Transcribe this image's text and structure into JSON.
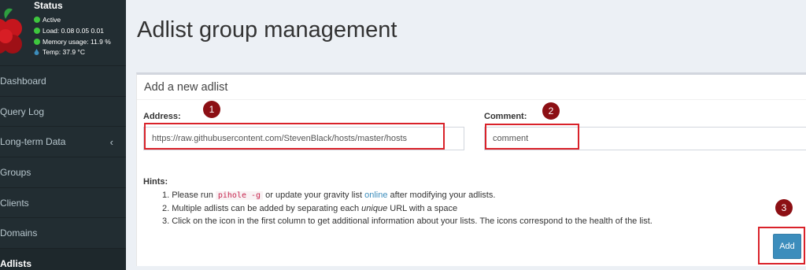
{
  "status": {
    "title": "Status",
    "active": "Active",
    "load": "Load:  0.08  0.05  0.01",
    "memory": "Memory usage:  11.9 %",
    "temp": "Temp: 37.9 °C"
  },
  "sidebar": {
    "items": [
      {
        "label": "Dashboard"
      },
      {
        "label": "Query Log"
      },
      {
        "label": "Long-term Data"
      },
      {
        "label": "Groups"
      },
      {
        "label": "Clients"
      },
      {
        "label": "Domains"
      },
      {
        "label": "Adlists"
      }
    ],
    "chevron": "‹"
  },
  "page": {
    "title": "Adlist group management"
  },
  "form": {
    "box_title": "Add a new adlist",
    "address_label": "Address:",
    "address_value": "https://raw.githubusercontent.com/StevenBlack/hosts/master/hosts",
    "comment_label": "Comment:",
    "comment_value": "comment",
    "hints_title": "Hints:",
    "hint1_pre": "1. Please run ",
    "hint1_code": "pihole -g",
    "hint1_mid": " or update your gravity list ",
    "hint1_link": "online",
    "hint1_post": " after modifying your adlists.",
    "hint2_pre": "2. Multiple adlists can be added by separating each ",
    "hint2_em": "unique",
    "hint2_post": " URL with a space",
    "hint3": "3. Click on the icon in the first column to get additional information about your lists. The icons correspond to the health of the list.",
    "add_label": "Add"
  },
  "annotations": {
    "one": "1",
    "two": "2",
    "three": "3"
  },
  "colors": {
    "sidebar_bg": "#222d32",
    "accent": "#3c8dbc",
    "highlight": "#d9222a",
    "badge": "#8c0f14"
  }
}
